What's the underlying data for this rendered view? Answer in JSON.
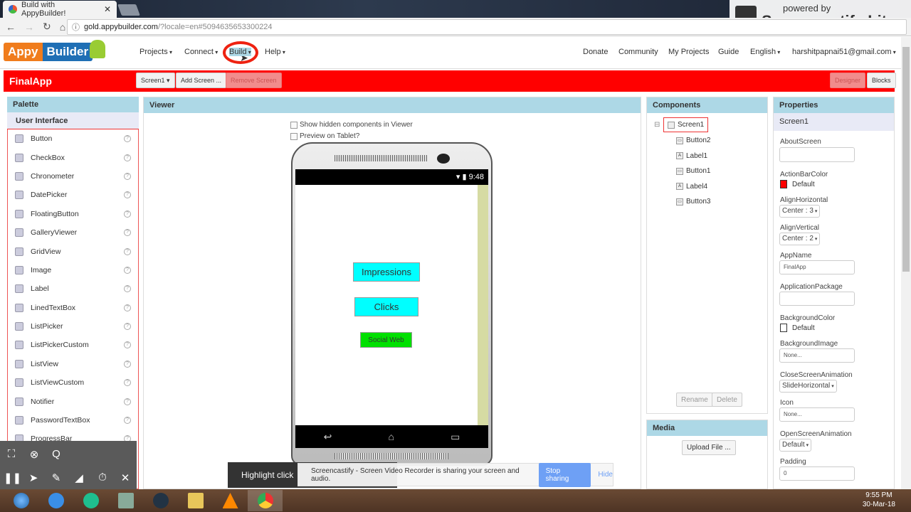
{
  "browser": {
    "tab_title": "Build with AppyBuilder!",
    "url_host": "gold.appybuilder.com",
    "url_rest": "/?locale=en#5094635653300224"
  },
  "recorder_badge": {
    "line1": "powered by",
    "line2": "Screencastify Lite"
  },
  "header": {
    "logo_left": "Appy",
    "logo_right": "Builder",
    "menus": [
      "Projects",
      "Connect",
      "Build",
      "Help"
    ],
    "right_links": [
      "Donate",
      "Community",
      "My Projects",
      "Guide",
      "English",
      "harshitpapnai51@gmail.com"
    ]
  },
  "toolbar": {
    "app_name": "FinalApp",
    "screen_select": "Screen1",
    "add_screen": "Add Screen ...",
    "remove_screen": "Remove Screen",
    "designer": "Designer",
    "blocks": "Blocks"
  },
  "palette": {
    "title": "Palette",
    "section": "User Interface",
    "items": [
      "Button",
      "CheckBox",
      "Chronometer",
      "DatePicker",
      "FloatingButton",
      "GalleryViewer",
      "GridView",
      "Image",
      "Label",
      "LinedTextBox",
      "ListPicker",
      "ListPickerCustom",
      "ListView",
      "ListViewCustom",
      "Notifier",
      "PasswordTextBox",
      "ProgressBar"
    ]
  },
  "viewer": {
    "title": "Viewer",
    "show_hidden": "Show hidden components in Viewer",
    "preview_tablet": "Preview on Tablet?",
    "time": "9:48",
    "buttons": [
      {
        "label": "Impressions",
        "color": "#00ffff"
      },
      {
        "label": "Clicks",
        "color": "#00ffff"
      },
      {
        "label": "Social Web",
        "color": "#00e000"
      }
    ]
  },
  "components": {
    "title": "Components",
    "root": "Screen1",
    "children": [
      "Button2",
      "Label1",
      "Button1",
      "Label4",
      "Button3"
    ],
    "rename": "Rename",
    "delete": "Delete"
  },
  "media": {
    "title": "Media",
    "upload": "Upload File ..."
  },
  "properties": {
    "title": "Properties",
    "selected": "Screen1",
    "about_label": "AboutScreen",
    "about_value": "",
    "actionbar_label": "ActionBarColor",
    "actionbar_value": "Default",
    "actionbar_color": "#ff0000",
    "alignh_label": "AlignHorizontal",
    "alignh_value": "Center : 3",
    "alignv_label": "AlignVertical",
    "alignv_value": "Center : 2",
    "appname_label": "AppName",
    "appname_value": "FinalApp",
    "package_label": "ApplicationPackage",
    "package_value": "",
    "bgcolor_label": "BackgroundColor",
    "bgcolor_value": "Default",
    "bgimage_label": "BackgroundImage",
    "bgimage_value": "None...",
    "close_anim_label": "CloseScreenAnimation",
    "close_anim_value": "SlideHorizontal",
    "icon_label": "Icon",
    "icon_value": "None...",
    "open_anim_label": "OpenScreenAnimation",
    "open_anim_value": "Default",
    "padding_label": "Padding",
    "padding_value": "0"
  },
  "overlay": {
    "highlight": "Highlight click",
    "notice": "Screencastify - Screen Video Recorder is sharing your screen and audio.",
    "stop": "Stop sharing",
    "hide": "Hide"
  },
  "taskbar": {
    "time": "9:55 PM",
    "date": "30-Mar-18"
  }
}
